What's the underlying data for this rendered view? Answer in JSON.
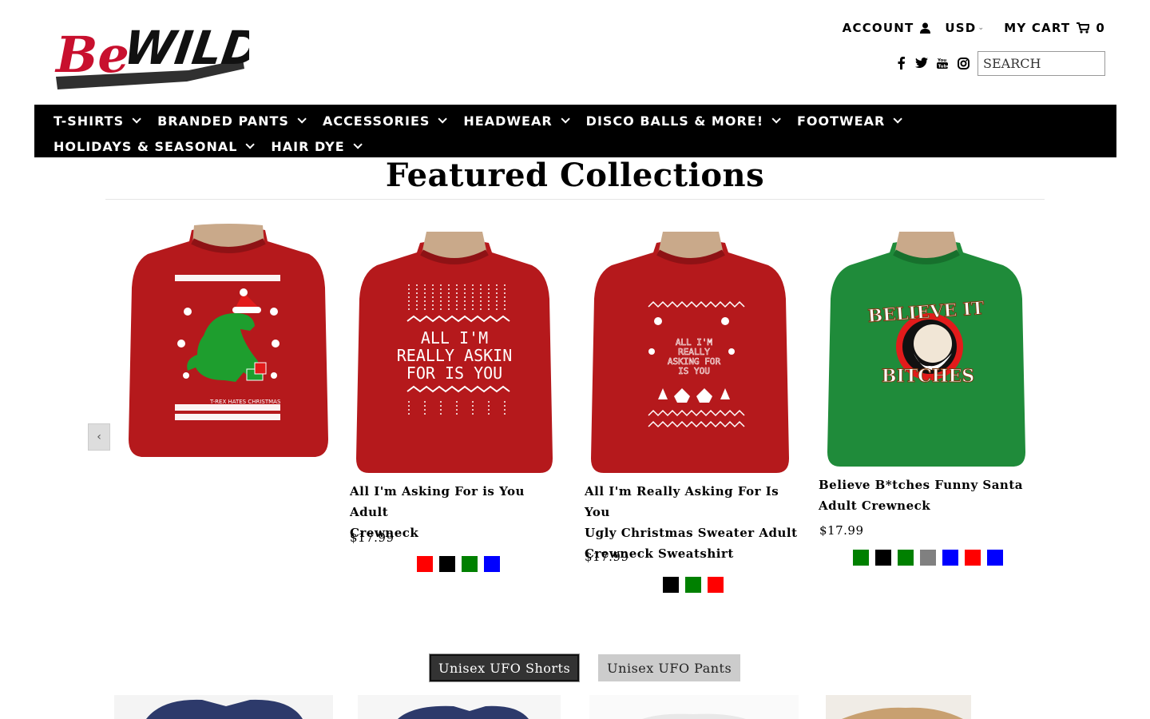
{
  "header": {
    "logo_text": "Be WILD",
    "account_label": "ACCOUNT",
    "currency_label": "USD",
    "cart_label": "MY CART",
    "cart_count": "0",
    "search_placeholder": "SEARCH",
    "social_icons": [
      "facebook-icon",
      "twitter-icon",
      "youtube-icon",
      "instagram-icon"
    ]
  },
  "nav": {
    "items": [
      {
        "label": "T-SHIRTS"
      },
      {
        "label": "BRANDED PANTS"
      },
      {
        "label": "ACCESSORIES"
      },
      {
        "label": "HEADWEAR"
      },
      {
        "label": "DISCO BALLS & MORE!"
      },
      {
        "label": "FOOTWEAR"
      },
      {
        "label": "HOLIDAYS & SEASONAL"
      },
      {
        "label": "HAIR DYE"
      }
    ]
  },
  "featured": {
    "title": "Featured Collections",
    "prev_label": "‹",
    "products": [
      {
        "image_alt": "T-Rex Hates Christmas",
        "image_text": "T-REX HATES CHRISTMAS",
        "name": "",
        "price": ""
      },
      {
        "image_alt": "All I'm Really Askin For Is You",
        "image_lines": [
          "ALL I'M",
          "REALLY ASKIN",
          "FOR IS YOU"
        ],
        "name_lines": [
          "All I'm Asking For is You Adult",
          "Crewneck"
        ],
        "price": "$17.99",
        "swatches": [
          "#ff0000",
          "#000000",
          "#008000",
          "#0000ff"
        ]
      },
      {
        "image_alt": "All I'm Really Asking For Is You",
        "image_lines": [
          "ALL I'M",
          "REALLY",
          "ASKING FOR",
          "IS YOU"
        ],
        "name_lines": [
          "All I'm Really Asking For Is You",
          "Ugly Christmas Sweater Adult",
          "Crewneck Sweatshirt"
        ],
        "price": "$17.99",
        "swatches": [
          "#000000",
          "#008000",
          "#ff0000"
        ]
      },
      {
        "image_alt": "Believe It Bitches",
        "image_lines": [
          "BELIEVE IT",
          "BITCHES"
        ],
        "name_lines": [
          "Believe B*tches Funny Santa",
          "Adult Crewneck"
        ],
        "price": "$17.99",
        "swatches": [
          "#008000",
          "#000000",
          "#008000",
          "#808080",
          "#0000ff",
          "#ff0000",
          "#0000ff"
        ]
      }
    ]
  },
  "tabs": [
    {
      "label": "Unisex UFO Shorts",
      "active": true
    },
    {
      "label": "Unisex UFO Pants",
      "active": false
    }
  ],
  "colors": {
    "nav_bg": "#000000",
    "logo_red": "#c8102e",
    "sweater_red": "#b5191c",
    "sweater_green": "#1f8b3a"
  }
}
